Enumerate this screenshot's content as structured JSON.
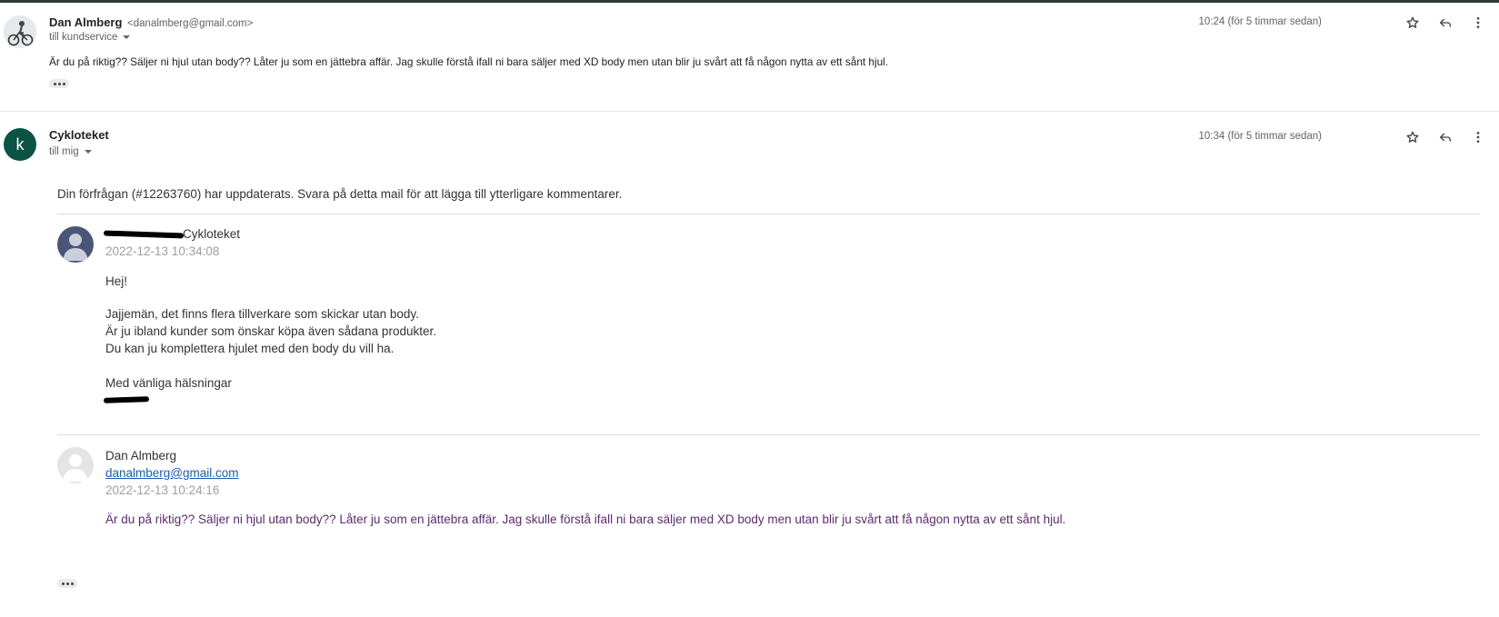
{
  "colors": {
    "accent_green": "#0b5345",
    "link_blue": "#1a5db0",
    "quoted_purple": "#5b2b6e"
  },
  "message1": {
    "sender_name": "Dan Almberg",
    "sender_email": "<danalmberg@gmail.com>",
    "to": "till kundservice",
    "time": "10:24 (för 5 timmar sedan)",
    "body": "Är du på riktig?? Säljer ni hjul utan body?? Låter ju som en jättebra affär. Jag skulle förstå ifall ni bara säljer med XD body men utan blir ju svårt att få någon nytta av ett sånt hjul."
  },
  "message2": {
    "avatar_letter": "k",
    "sender_name": "Cykloteket",
    "to": "till mig",
    "time": "10:34 (för 5 timmar sedan)",
    "intro": "Din förfrågan (#12263760) har uppdaterats. Svara på detta mail för att lägga till ytterligare kommentarer.",
    "reply": {
      "author_visible": "Cykloteket",
      "date": "2022-12-13 10:34:08",
      "greeting": "Hej!",
      "lines": [
        "Jajjemän, det finns flera tillverkare som skickar utan body.",
        "Är ju ibland kunder som önskar köpa även sådana produkter.",
        "Du kan ju komplettera hjulet med den body du vill ha."
      ],
      "closing": "Med vänliga hälsningar"
    },
    "original": {
      "name": "Dan Almberg",
      "email": "danalmberg@gmail.com",
      "date": "2022-12-13 10:24:16",
      "body": "Är du på riktig?? Säljer ni hjul utan body?? Låter ju som en jättebra affär. Jag skulle förstå ifall ni bara säljer med XD body men utan blir ju svårt att få någon nytta av ett sånt hjul."
    }
  },
  "icons": [
    "star-icon",
    "reply-icon",
    "more-vert-icon",
    "person-icon",
    "cyclist-avatar"
  ]
}
